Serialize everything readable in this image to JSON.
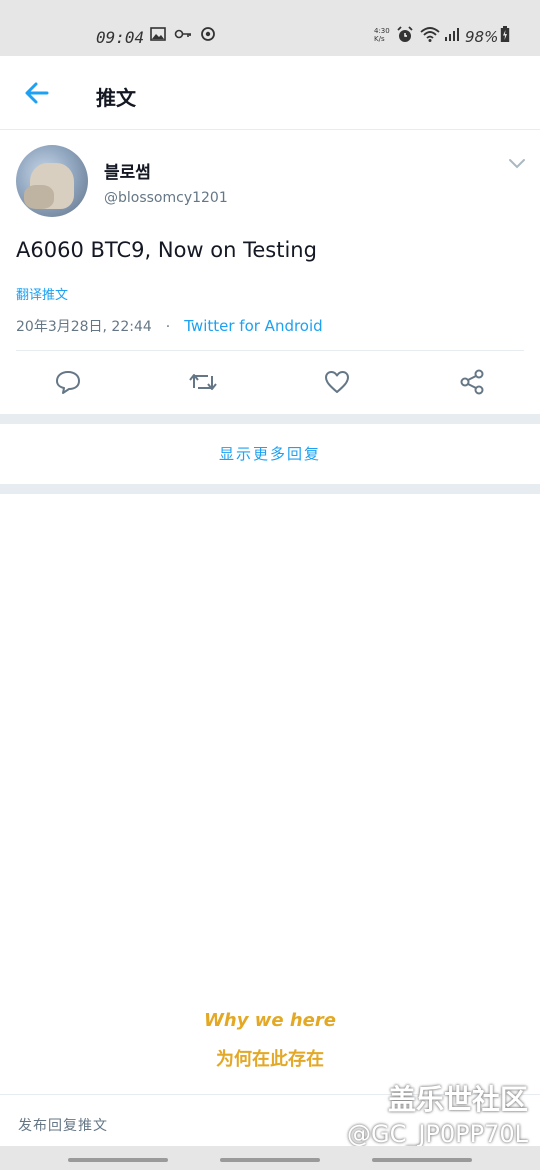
{
  "status_bar": {
    "time": "09:04",
    "net_speed": "4:30 K/s",
    "battery": "98%",
    "icons": [
      "image-icon",
      "key-icon",
      "sync-icon",
      "alarm-icon",
      "wifi-icon",
      "signal-icon",
      "battery-icon"
    ]
  },
  "app_bar": {
    "title": "推文",
    "back_icon": "arrow-left-icon"
  },
  "tweet": {
    "display_name": "블로썸",
    "handle": "@blossomcy1201",
    "text": "A6060 BTC9, Now on Testing",
    "translate_label": "翻译推文",
    "date": "20年3月28日, 22:44",
    "separator": "·",
    "source": "Twitter for Android",
    "actions": [
      "reply-icon",
      "retweet-icon",
      "like-icon",
      "share-icon"
    ]
  },
  "show_more_replies": "显示更多回复",
  "watermark": {
    "en": "Why we here",
    "zh": "为何在此存在"
  },
  "reply_placeholder": "发布回复推文",
  "corner_watermark": {
    "line1": "盖乐世社区",
    "line2": "@GC_JP0PP70L"
  },
  "colors": {
    "accent": "#1da1f2",
    "secondary_text": "#657786",
    "divider": "#e6ecf0",
    "watermark_gold": "#e3a826"
  }
}
